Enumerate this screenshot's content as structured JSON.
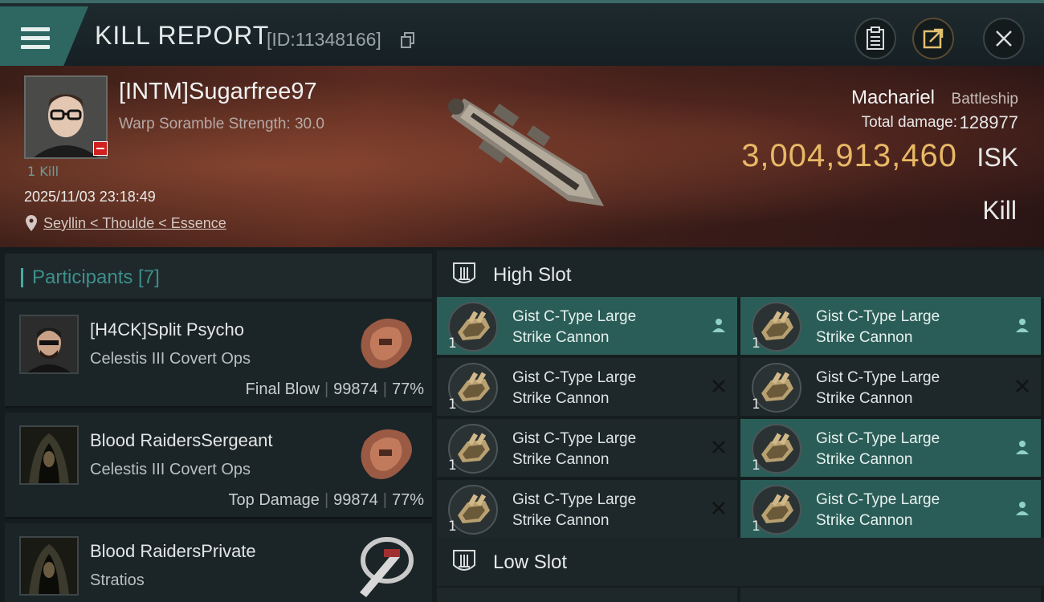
{
  "header": {
    "title": "KILL REPORT",
    "report_id": "[ID:11348166]"
  },
  "victim": {
    "name": "[INTM]Sugarfree97",
    "warp_scramble": "Warp Soramble Strength: 30.0",
    "kill_count": "1 Kill",
    "datetime": "2025/11/03 23:18:49",
    "location": "Seyllin < Thoulde < Essence",
    "ship_name": "Machariel",
    "ship_class": "Battleship",
    "total_damage_label": "Total damage:",
    "total_damage": "128977",
    "isk_value": "3,004,913,460",
    "isk_unit": "ISK",
    "result": "Kill"
  },
  "participants": {
    "title": "Participants [7]",
    "items": [
      {
        "name": "[H4CK]Split Psycho",
        "ship": "Celestis III Covert Ops",
        "role": "Final Blow",
        "damage": "99874",
        "percent": "77%"
      },
      {
        "name": "Blood RaidersSergeant",
        "ship": "Celestis III Covert Ops",
        "role": "Top Damage",
        "damage": "99874",
        "percent": "77%"
      },
      {
        "name": "Blood RaidersPrivate",
        "ship": "Stratios"
      }
    ]
  },
  "slots": {
    "high": {
      "title": "High Slot",
      "modules": [
        {
          "line1": "Gist C-Type Large",
          "line2": "Strike Cannon",
          "qty": "1",
          "state": "fitted"
        },
        {
          "line1": "Gist C-Type Large",
          "line2": "Strike Cannon",
          "qty": "1",
          "state": "fitted"
        },
        {
          "line1": "Gist C-Type Large",
          "line2": "Strike Cannon",
          "qty": "1",
          "state": "destroyed"
        },
        {
          "line1": "Gist C-Type Large",
          "line2": "Strike Cannon",
          "qty": "1",
          "state": "destroyed"
        },
        {
          "line1": "Gist C-Type Large",
          "line2": "Strike Cannon",
          "qty": "1",
          "state": "destroyed"
        },
        {
          "line1": "Gist C-Type Large",
          "line2": "Strike Cannon",
          "qty": "1",
          "state": "fitted"
        },
        {
          "line1": "Gist C-Type Large",
          "line2": "Strike Cannon",
          "qty": "1",
          "state": "destroyed"
        },
        {
          "line1": "Gist C-Type Large",
          "line2": "Strike Cannon",
          "qty": "1",
          "state": "fitted"
        }
      ]
    },
    "low": {
      "title": "Low Slot"
    }
  },
  "colors": {
    "accent": "#3d8f8b",
    "isk": "#e8b866",
    "fitted": "#2b5d58",
    "destroyed_bg": "#1e2729"
  }
}
